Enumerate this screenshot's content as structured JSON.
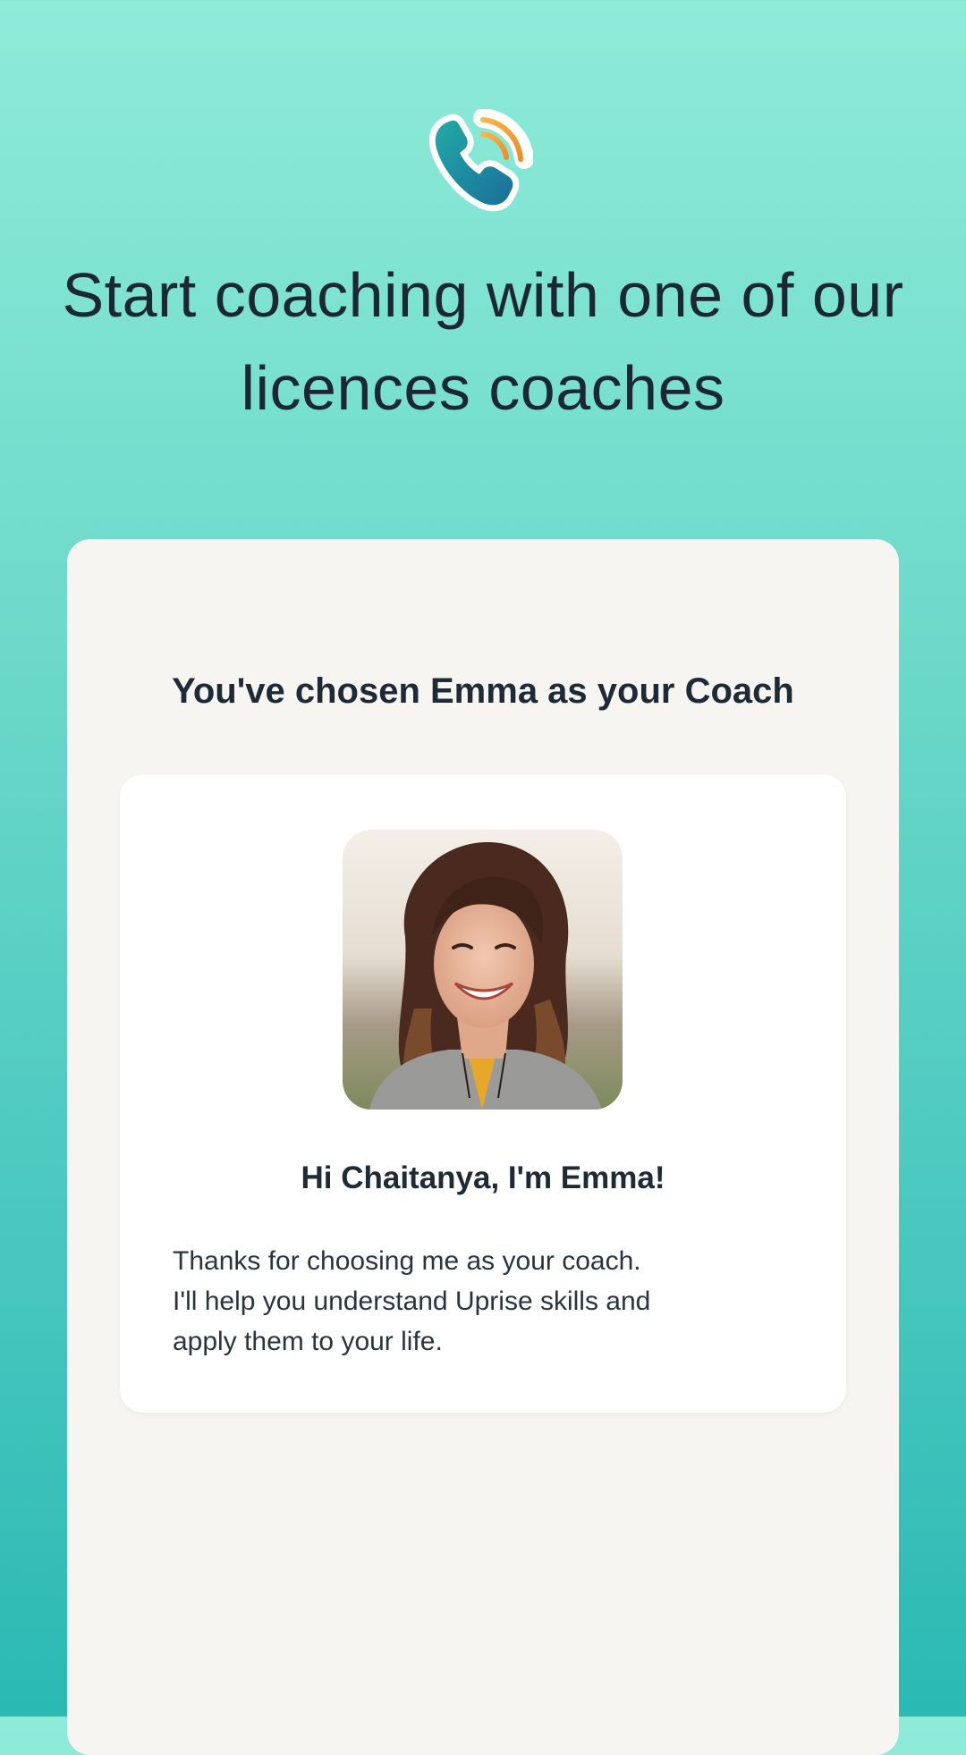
{
  "header": {
    "icon": "phone-call-icon",
    "title": "Start coaching with one of our licences coaches"
  },
  "panel": {
    "chosen_title": "You've chosen Emma as your Coach"
  },
  "coach_card": {
    "photo": "coach-portrait",
    "greeting": "Hi Chaitanya, I'm Emma!",
    "message_lines": [
      "Thanks for choosing me as your coach.",
      "I'll help you understand Uprise skills and",
      "apply them to your life."
    ]
  },
  "colors": {
    "gradient_top": "#8eebd8",
    "gradient_bottom": "#2bb9b4",
    "panel_bg": "#f7f5f2",
    "card_bg": "#ffffff",
    "text_dark": "#1f2a37",
    "icon_teal": "#1e8fa6",
    "icon_orange": "#f5a532"
  }
}
